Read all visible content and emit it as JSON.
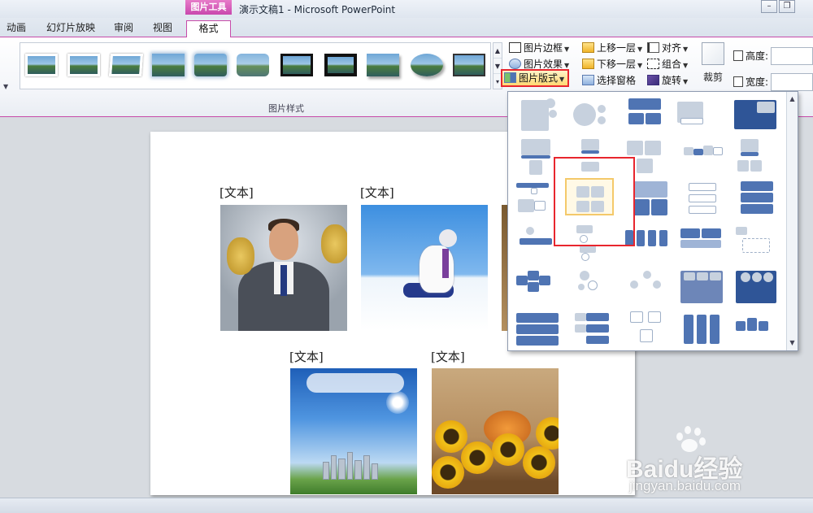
{
  "titlebar": {
    "context_tab": "图片工具",
    "title": "演示文稿1  -  Microsoft PowerPoint",
    "controls": [
      "–",
      "❐"
    ]
  },
  "tabs": [
    {
      "label": "动画"
    },
    {
      "label": "幻灯片放映"
    },
    {
      "label": "审阅"
    },
    {
      "label": "视图"
    },
    {
      "label": "格式",
      "active": true
    }
  ],
  "ribbon": {
    "group_label": "图片样式",
    "picture_border": "图片边框",
    "picture_effects": "图片效果",
    "picture_layout": "图片版式",
    "bring_forward": "上移一层",
    "send_backward": "下移一层",
    "selection_pane": "选择窗格",
    "align": "对齐",
    "group": "组合",
    "rotate": "旋转",
    "crop": "裁剪",
    "height_label": "高度:",
    "width_label": "宽度:"
  },
  "slide": {
    "labels": [
      "[文本]",
      "[文本]",
      "[文本]",
      "[文本]"
    ]
  },
  "watermark": {
    "brand": "Baidu经验",
    "url": "jingyan.baidu.com"
  },
  "colors": {
    "context_accent": "#c74ba9",
    "highlight_red": "#e8262e",
    "layout_blue": "#4f74b3",
    "selection_gold": "#f4c96a"
  }
}
